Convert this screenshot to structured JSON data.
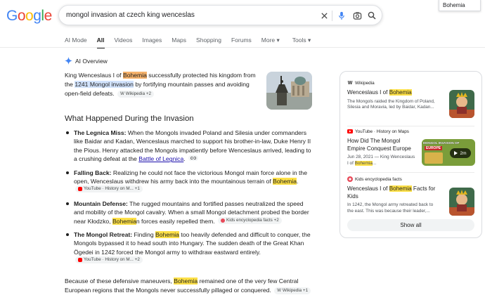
{
  "find_box": {
    "value": "Bohemia"
  },
  "logo": {
    "letters": [
      "G",
      "o",
      "o",
      "g",
      "l",
      "e"
    ]
  },
  "search": {
    "query": "mongol invasion at czech king wenceslas"
  },
  "tabs": [
    {
      "label": "AI Mode"
    },
    {
      "label": "All"
    },
    {
      "label": "Videos"
    },
    {
      "label": "Images"
    },
    {
      "label": "Maps"
    },
    {
      "label": "Shopping"
    },
    {
      "label": "Forums"
    },
    {
      "label": "More ▾"
    },
    {
      "label": "Tools ▾"
    }
  ],
  "ai_overview": {
    "label": "AI Overview",
    "intro": {
      "t1": "King Wenceslaus I of ",
      "hl1": "Bohemia",
      "t2": " successfully protected his kingdom from the ",
      "hl2": "1241 Mongol invasion",
      "t3": " by fortifying mountain passes and avoiding open-field defeats.",
      "chip": "Wikipedia +2"
    },
    "heading": "What Happened During the Invasion",
    "bullets": [
      {
        "title": "The Legnica Miss:",
        "text": " When the Mongols invaded Poland and Silesia under commanders like Baidar and Kadan, Wenceslaus marched to support his brother-in-law, Duke Henry II the Pious. Henry attacked the Mongols impatiently before Wenceslaus arrived, leading to a crushing defeat at the ",
        "link": "Battle of Legnica",
        "end": "."
      },
      {
        "title": "Falling Back:",
        "text": " Realizing he could not face the victorious Mongol main force alone in the open, Wenceslaus withdrew his army back into the mountainous terrain of ",
        "hl": "Bohemia",
        "end": ".",
        "chip": "YouTube · History on M... +1"
      },
      {
        "title": "Mountain Defense:",
        "text": " The rugged mountains and fortified passes neutralized the speed and mobility of the Mongol cavalry. When a small Mongol detachment probed the border near Kłodzko, ",
        "hl": "Bohemia",
        "end": "n forces easily repelled them.",
        "chip": "Kids encyclopedia facts +2"
      },
      {
        "title": "The Mongol Retreat:",
        "text": " Finding ",
        "hl": "Bohemia",
        "end": " too heavily defended and difficult to conquer, the Mongols bypassed it to head south into Hungary. The sudden death of the Great Khan Ögedei in 1242 forced the Mongol army to withdraw eastward entirely.",
        "chip": "YouTube · History on M... +2"
      }
    ],
    "outro": {
      "t1": "Because of these defensive maneuvers, ",
      "hl": "Bohemia",
      "t2": " remained one of the very few Central European regions that the Mongols never successfully pillaged or conquered.",
      "chip": "Wikipedia +1"
    }
  },
  "sources": [
    {
      "site": "Wikipedia",
      "title_a": "Wenceslaus I of ",
      "title_hl": "Bohemia",
      "title_b": "",
      "snippet": "The Mongols raided the Kingdom of Poland, Silesia and Moravia, led by Baidar, Kadan..."
    },
    {
      "site": "YouTube · History on Maps",
      "title_a": "How Did The Mongol Empire Conquest Europe",
      "title_hl": "",
      "title_b": "",
      "snippet_a": "Jun 28, 2021 — King Wenceslaus I of ",
      "snippet_hl": "Bohemia",
      "snippet_b": "...",
      "thumb_label": "MONGOL INVASION OF",
      "thumb_label2": "EUROPE",
      "duration": "2m"
    },
    {
      "site": "Kids encyclopedia facts",
      "title_a": "Wenceslaus I of ",
      "title_hl": "Bohemia",
      "title_b": " Facts for Kids",
      "snippet": "In 1242, the Mongol army retreated back to the east. This was because their leader,..."
    }
  ],
  "show_all": "Show all",
  "colors": {
    "highlight": "#fde047",
    "link": "#1a0dab",
    "ai_star": "#4285f4"
  }
}
